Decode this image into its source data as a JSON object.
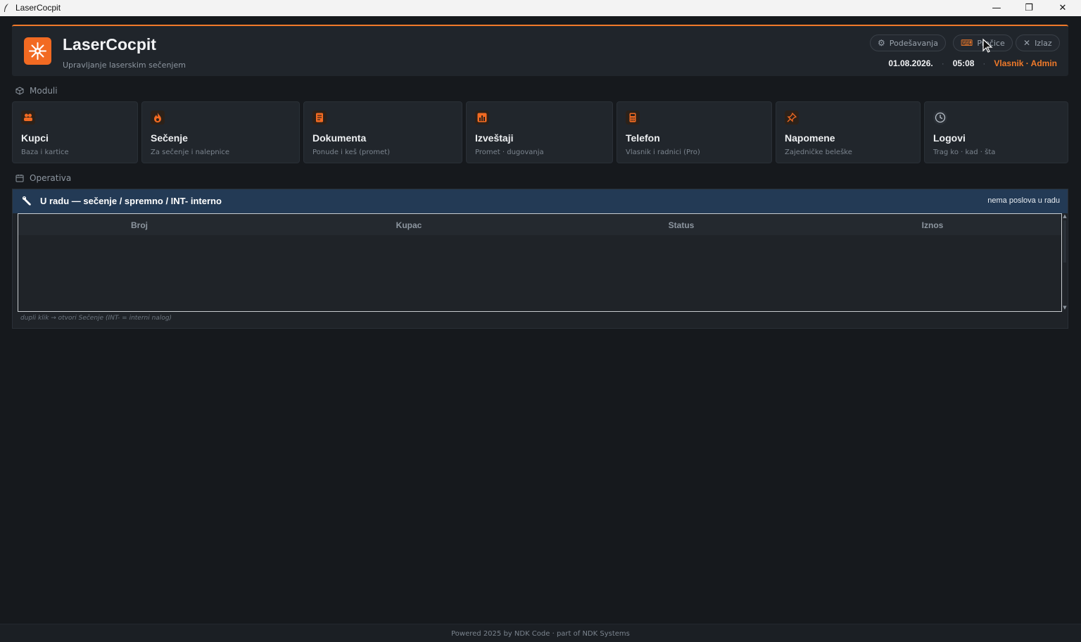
{
  "window": {
    "title": "LaserCocpit",
    "minimize": "—",
    "restore": "❐",
    "close": "✕"
  },
  "header": {
    "app_name": "LaserCocpit",
    "subtitle": "Upravljanje laserskim sečenjem",
    "buttons": {
      "settings": "Podešavanja",
      "keyboard": "Prečice",
      "exit": "Izlaz"
    },
    "date": "01.08.2026.",
    "time": "05:08",
    "user": "Vlasnik · Admin",
    "separator": "·",
    "accent": "#f07a2a"
  },
  "modules": {
    "label": "Moduli",
    "items": [
      {
        "title": "Kupci",
        "subtitle": "Baza i kartice",
        "icon": "people-icon"
      },
      {
        "title": "Sečenje",
        "subtitle": "Za sečenje i nalepnice",
        "icon": "flame-icon"
      },
      {
        "title": "Dokumenta",
        "subtitle": "Ponude i keš (promet)",
        "icon": "document-icon"
      },
      {
        "title": "Izveštaji",
        "subtitle": "Promet · dugovanja",
        "icon": "chart-icon"
      },
      {
        "title": "Telefon",
        "subtitle": "Vlasnik i radnici (Pro)",
        "icon": "phone-icon"
      },
      {
        "title": "Napomene",
        "subtitle": "Zajedničke beleške",
        "icon": "pin-icon"
      },
      {
        "title": "Logovi",
        "subtitle": "Trag ko · kad · šta",
        "icon": "clock-icon"
      }
    ]
  },
  "operativa": {
    "label": "Operativa",
    "panel_title": "U radu — sečenje / spremno / INT- interno",
    "panel_status": "nema poslova u radu",
    "columns": [
      "Broj",
      "Kupac",
      "Status",
      "Iznos"
    ],
    "rows": [],
    "hint": "dupli klik → otvori Sečenje (INT- = interni nalog)"
  },
  "footer": {
    "text": "Powered 2025 by NDK Code  ·  part of NDK Systems"
  }
}
